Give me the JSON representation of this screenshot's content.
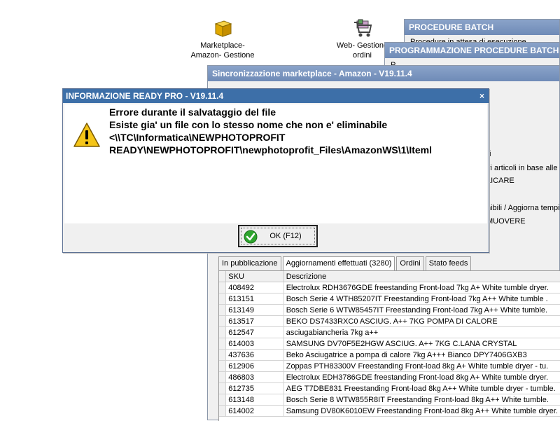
{
  "desktop": {
    "icons": [
      {
        "label_line1": "Marketplace-",
        "label_line2": "Amazon- Gestione"
      },
      {
        "label_line1": "Web- Gestione",
        "label_line2": "ordini"
      }
    ]
  },
  "windows": {
    "batch": {
      "title": "PROCEDURE BATCH",
      "text": "Procedure in attesa di esecuzione"
    },
    "programming": {
      "title": "PROGRAMMAZIONE PROCEDURE BATCH",
      "text": "P"
    },
    "sync": {
      "title": "Sincronizzazione marketplace - Amazon - V19.11.4",
      "side_texts": [
        "i",
        "vi articoli in base alle r",
        "LICARE",
        "nibili / Aggiorna tempi",
        "MUOVERE"
      ]
    }
  },
  "dialog": {
    "title": "INFORMAZIONE READY PRO - V19.11.4",
    "close": "×",
    "message_lines": [
      "Errore durante il salvataggio del file",
      "Esiste gia' un file con lo stesso nome che non e' eliminabile",
      "<\\\\TC\\Informatica\\NEWPHOTOPROFIT",
      "READY\\NEWPHOTOPROFIT\\newphotoprofit_Files\\AmazonWS\\1\\Iteml"
    ],
    "ok_label": "OK (F12)"
  },
  "tabs": [
    {
      "label": "In pubblicazione",
      "active": false
    },
    {
      "label": "Aggiornamenti effettuati (3280)",
      "active": true
    },
    {
      "label": "Ordini",
      "active": false
    },
    {
      "label": "Stato feeds",
      "active": false
    }
  ],
  "grid": {
    "columns": [
      "SKU",
      "Descrizione"
    ],
    "rows": [
      [
        "408492",
        "Electrolux RDH3676GDE freestanding Front-load 7kg A+ White tumble dryer."
      ],
      [
        "613151",
        "Bosch Serie 4 WTH85207IT Freestanding Front-load 7kg A++ White tumble ."
      ],
      [
        "613149",
        "Bosch Serie 6 WTW85457IT Freestanding Front-load 7kg A++ White tumble."
      ],
      [
        "613517",
        "BEKO DS7433RXC0 ASCIUG. A++ 7KG POMPA DI CALORE"
      ],
      [
        "612547",
        "asciugabiancheria 7kg a++"
      ],
      [
        "614003",
        "SAMSUNG DV70F5E2HGW ASCIUG. A++ 7KG C.LANA CRYSTAL"
      ],
      [
        "437636",
        "Beko Asciugatrice a pompa di calore 7kg A+++ Bianco DPY7406GXB3"
      ],
      [
        "612906",
        "Zoppas PTH83300V Freestanding Front-load 8kg A+ White tumble dryer - tu."
      ],
      [
        "486803",
        "Electrolux EDH3786GDE freestanding Front-load 8kg A+ White tumble dryer."
      ],
      [
        "612735",
        "AEG T7DBE831 Freestanding Front-load 8kg A++ White tumble dryer - tumble."
      ],
      [
        "613148",
        "Bosch Serie 8 WTW855R8IT Freestanding Front-load 8kg A++ White tumble."
      ],
      [
        "614002",
        "Samsung DV80K6010EW Freestanding Front-load 8kg A++ White tumble dryer."
      ]
    ]
  }
}
